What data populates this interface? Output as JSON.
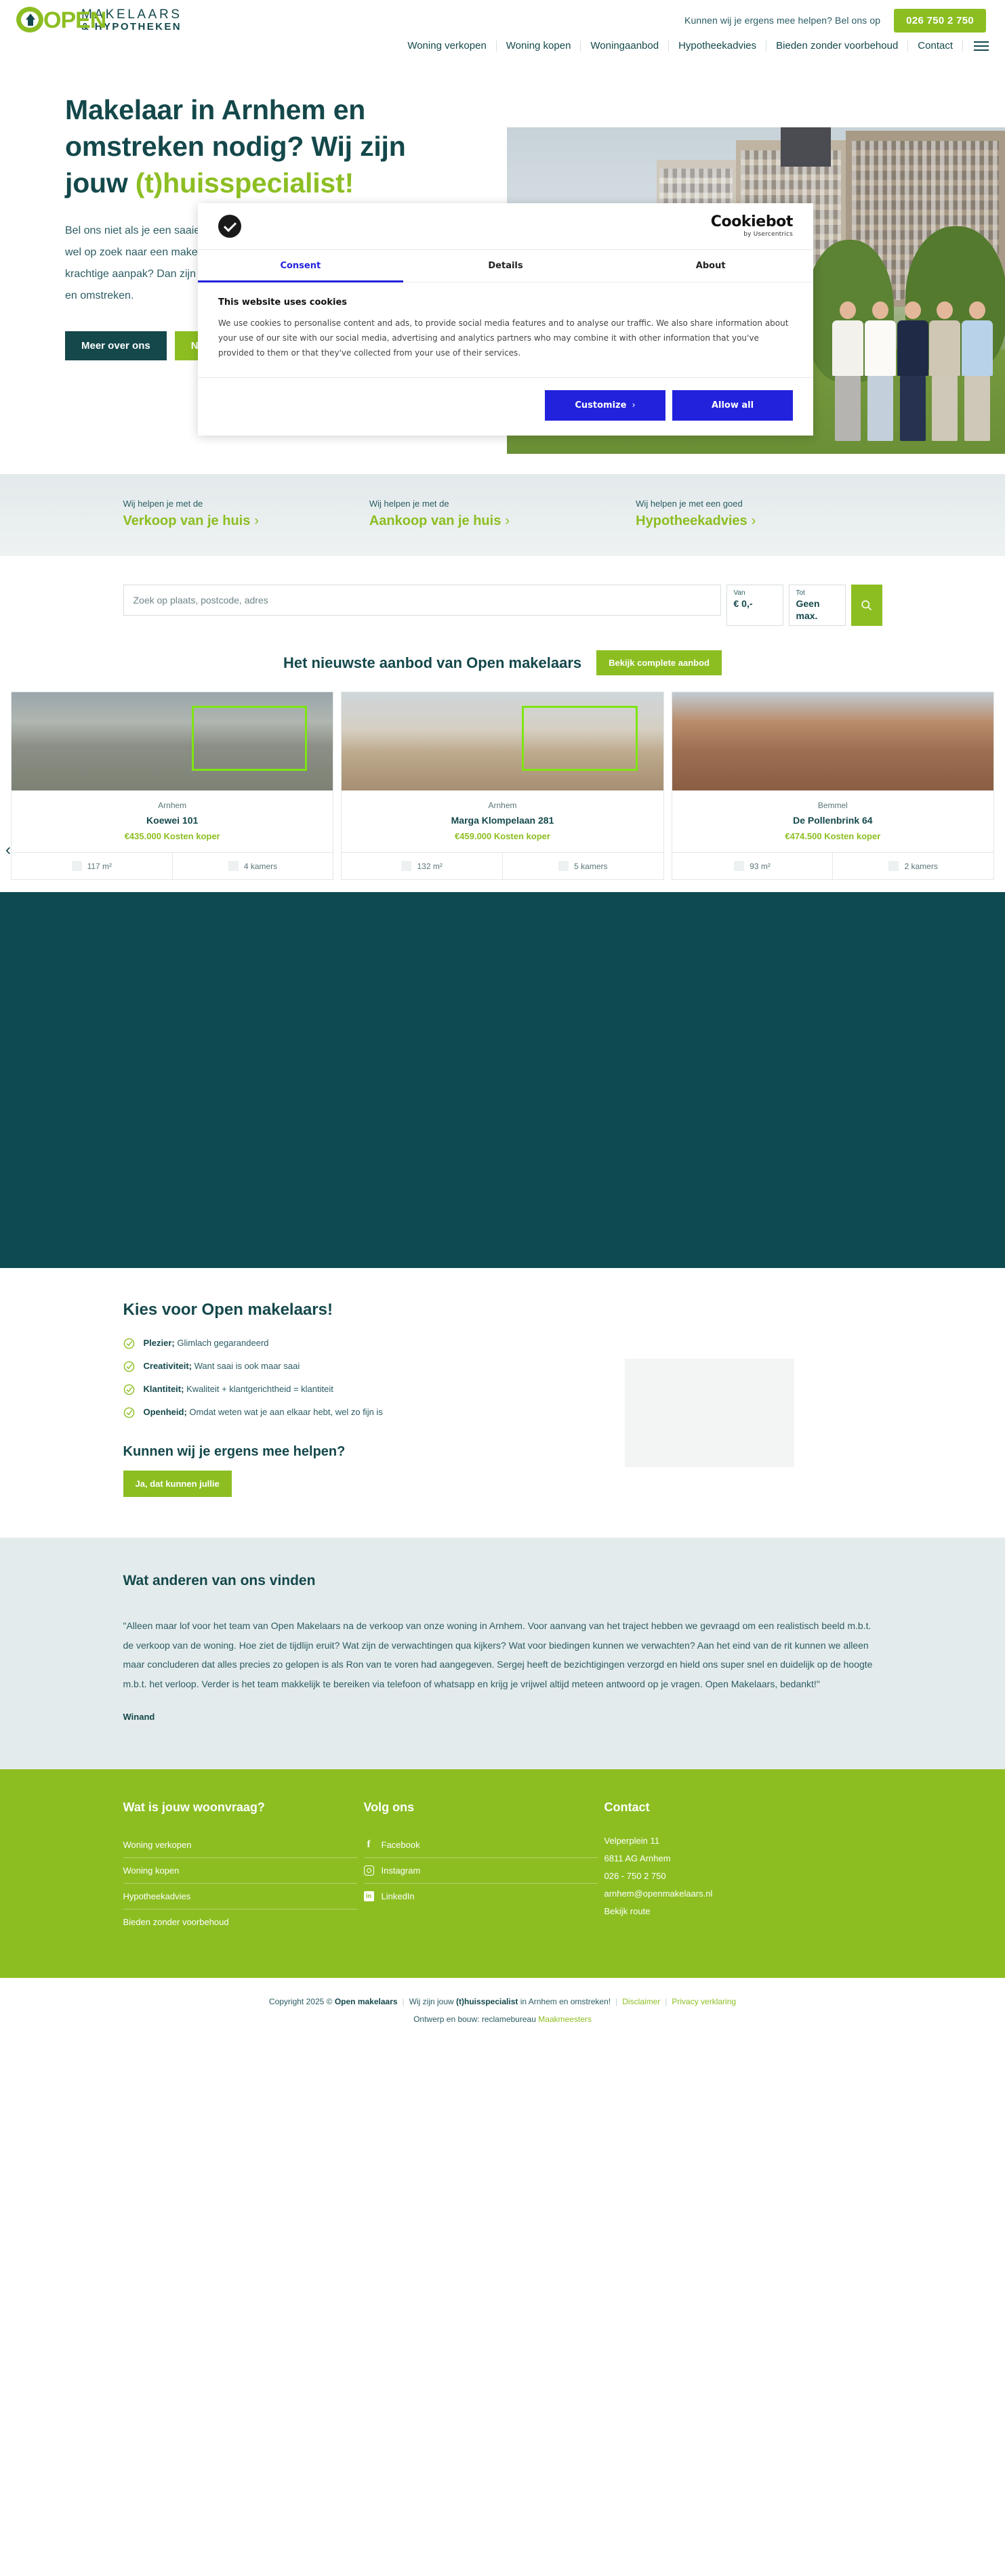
{
  "header": {
    "logo": {
      "word": "OPEN",
      "line1": "MAKELAARS",
      "line2": "& HYPOTHEKEN",
      "icon": "open-house-logo"
    },
    "help_text": "Kunnen wij je ergens mee helpen? Bel ons op",
    "phone": "026 750 2 750",
    "nav": [
      {
        "label": "Woning verkopen"
      },
      {
        "label": "Woning kopen"
      },
      {
        "label": "Woningaanbod"
      },
      {
        "label": "Hypotheekadvies"
      },
      {
        "label": "Bieden zonder voorbehoud"
      },
      {
        "label": "Contact"
      }
    ]
  },
  "hero": {
    "title_part1": "Makelaar in Arnhem en omstreken nodig? Wij zijn jouw ",
    "title_accent": "(t)huisspecialist!",
    "paragraph": "Bel ons niet als je een saaie makelaar zoekt. Maar ben je wel op zoek naar een makelaar met een frisse blik en een krachtige aanpak? Dan zijn wij jouw makelaar in Arnhem en omstreken.",
    "btn_primary": "Meer over ons",
    "btn_secondary": "Neem contact op"
  },
  "cookie": {
    "brand": "Cookiebot",
    "brand_sub": "by Usercentrics",
    "tabs": [
      {
        "label": "Consent",
        "active": true
      },
      {
        "label": "Details",
        "active": false
      },
      {
        "label": "About",
        "active": false
      }
    ],
    "heading": "This website uses cookies",
    "body": "We use cookies to personalise content and ads, to provide social media features and to analyse our traffic. We also share information about your use of our site with our social media, advertising and analytics partners who may combine it with other information that you've provided to them or that they've collected from your use of their services.",
    "btn_customize": "Customize",
    "btn_customize_chevron": "›",
    "btn_allow": "Allow all"
  },
  "help_strip": [
    {
      "small": "Wij helpen je met de",
      "big": "Verkoop van je huis",
      "chevron": "›"
    },
    {
      "small": "Wij helpen je met de",
      "big": "Aankoop van je huis",
      "chevron": "›"
    },
    {
      "small": "Wij helpen je met een goed",
      "big": "Hypotheekadvies",
      "chevron": "›"
    }
  ],
  "search": {
    "placeholder": "Zoek op plaats, postcode, adres",
    "from_label": "Van",
    "from_value": "€ 0,-",
    "to_label": "Tot",
    "to_value": "Geen max.",
    "button_icon": "search-icon"
  },
  "offer": {
    "title": "Het nieuwste aanbod van Open makelaars",
    "button": "Bekijk complete aanbod",
    "prev_arrow": "‹",
    "cards": [
      {
        "city": "Arnhem",
        "address": "Koewei 101",
        "price": "€435.000 Kosten koper",
        "area": "117 m²",
        "rooms": "4 kamers"
      },
      {
        "city": "Arnhem",
        "address": "Marga Klompelaan 281",
        "price": "€459.000 Kosten koper",
        "area": "132 m²",
        "rooms": "5 kamers"
      },
      {
        "city": "Bemmel",
        "address": "De Pollenbrink 64",
        "price": "€474.500 Kosten koper",
        "area": "93 m²",
        "rooms": "2 kamers"
      }
    ]
  },
  "choose": {
    "title": "Kies voor Open makelaars!",
    "usps": [
      {
        "bold": "Plezier;",
        "rest": " Glimlach gegarandeerd"
      },
      {
        "bold": "Creativiteit;",
        "rest": " Want saai is ook maar saai"
      },
      {
        "bold": "Klantiteit;",
        "rest": " Kwaliteit + klantgerichtheid = klantiteit"
      },
      {
        "bold": "Openheid;",
        "rest": " Omdat weten wat je aan elkaar hebt, wel zo fijn is"
      }
    ],
    "subtitle": "Kunnen wij je ergens mee helpen?",
    "button": "Ja, dat kunnen jullie"
  },
  "review": {
    "title": "Wat anderen van ons vinden",
    "text": "\"Alleen maar lof voor het team van Open Makelaars na de verkoop van onze woning in Arnhem. Voor aanvang van het traject hebben we gevraagd om een realistisch beeld m.b.t. de verkoop van de woning. Hoe ziet de tijdlijn eruit? Wat zijn de verwachtingen qua kijkers? Wat voor biedingen kunnen we verwachten? Aan het eind van de rit kunnen we alleen maar concluderen dat alles precies zo gelopen is als Ron van te voren had aangegeven. Sergej heeft de bezichtigingen verzorgd en hield ons super snel en duidelijk op de hoogte m.b.t. het verloop. Verder is het team makkelijk te bereiken via telefoon of whatsapp en krijg je vrijwel altijd meteen antwoord op je vragen. Open Makelaars, bedankt!\"",
    "author": "Winand"
  },
  "footer": {
    "col1_title": "Wat is jouw woonvraag?",
    "col1_links": [
      {
        "label": "Woning verkopen"
      },
      {
        "label": "Woning kopen"
      },
      {
        "label": "Hypotheekadvies"
      },
      {
        "label": "Bieden zonder voorbehoud"
      }
    ],
    "col2_title": "Volg ons",
    "col2_links": [
      {
        "label": "Facebook",
        "icon": "facebook-icon",
        "glyph": "f"
      },
      {
        "label": "Instagram",
        "icon": "instagram-icon",
        "glyph": ""
      },
      {
        "label": "LinkedIn",
        "icon": "linkedin-icon",
        "glyph": "in"
      }
    ],
    "col3_title": "Contact",
    "address1": "Velperplein 11",
    "address2": "6811 AG Arnhem",
    "phone": "026 - 750 2 750",
    "email": "arnhem@openmakelaars.nl",
    "route_link": "Bekijk route"
  },
  "copyright": {
    "pre": "Copyright 2025 © ",
    "brand": "Open makelaars",
    "mid1": "Wij zijn jouw ",
    "bold": "(t)huisspecialist",
    "mid2": " in Arnhem en omstreken!",
    "disclaimer": "Disclaimer",
    "privacy": "Privacy verklaring",
    "build_pre": "Ontwerp en bouw: reclamebureau ",
    "build_link": "Maakmeesters"
  },
  "colors": {
    "green": "#8cbe22",
    "teal": "#14484b",
    "teal_dark": "#0d4b50",
    "cookie_blue": "#2222dd"
  }
}
